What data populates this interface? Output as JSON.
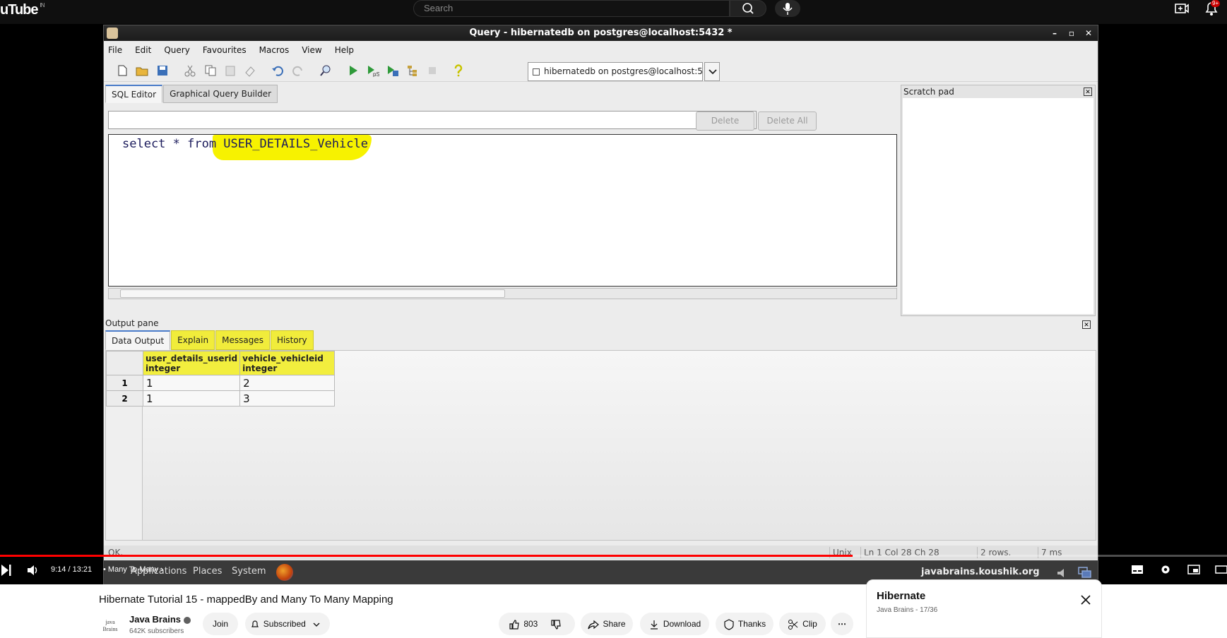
{
  "youtube": {
    "logo": "uTube",
    "region": "IN",
    "search_placeholder": "Search",
    "notification_count": "9+"
  },
  "window": {
    "title": "Query - hibernatedb on postgres@localhost:5432 *",
    "menu": [
      "File",
      "Edit",
      "Query",
      "Favourites",
      "Macros",
      "View",
      "Help"
    ],
    "connection": "hibernatedb on postgres@localhost:5"
  },
  "editor": {
    "tabs": [
      "SQL Editor",
      "Graphical Query Builder"
    ],
    "delete_label": "Delete",
    "delete_all_label": "Delete All",
    "sql_prefix": "select * from ",
    "sql_table": "USER_DETAILS_Vehicle"
  },
  "scratch_pad": {
    "title": "Scratch pad"
  },
  "output": {
    "title": "Output pane",
    "tabs": [
      "Data Output",
      "Explain",
      "Messages",
      "History"
    ],
    "columns": [
      {
        "name": "user_details_userid",
        "type": "integer"
      },
      {
        "name": "vehicle_vehicleid",
        "type": "integer"
      }
    ],
    "rows": [
      {
        "num": "1",
        "values": [
          "1",
          "2"
        ]
      },
      {
        "num": "2",
        "values": [
          "1",
          "3"
        ]
      }
    ]
  },
  "status": {
    "message": "OK.",
    "line_ending": "Unix",
    "position": "Ln 1 Col 28 Ch 28",
    "rows": "2 rows.",
    "time": "7 ms"
  },
  "taskbar": {
    "items": [
      "Applications",
      "Places",
      "System"
    ],
    "site": "javabrains.koushik.org"
  },
  "player": {
    "time": "9:14 / 13:21",
    "chapter": "• Many To Many ›",
    "progress": 0.695
  },
  "video": {
    "title": "Hibernate Tutorial 15 - mappedBy and Many To Many Mapping",
    "channel_logo_text": "java Brains",
    "channel": "Java Brains",
    "subscribers": "642K subscribers",
    "join": "Join",
    "subscribed": "Subscribed",
    "likes": "803",
    "share": "Share",
    "download": "Download",
    "thanks": "Thanks",
    "clip": "Clip"
  },
  "playlist": {
    "title": "Hibernate",
    "subtitle": "Java Brains - 17/36"
  }
}
